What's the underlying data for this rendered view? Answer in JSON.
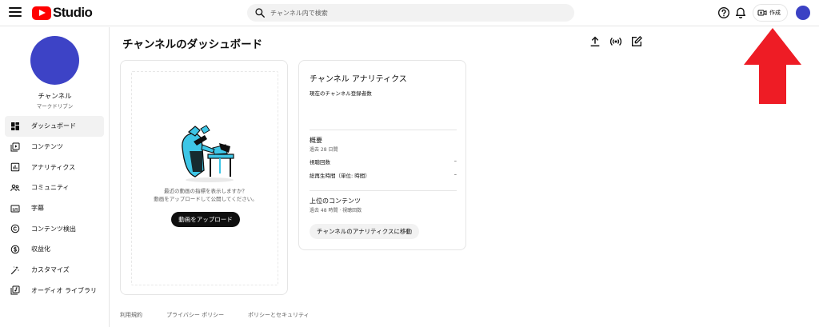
{
  "header": {
    "logo_text": "Studio",
    "search_placeholder": "チャンネル内で検索",
    "create_label": "作成"
  },
  "sidebar": {
    "channel_name": "チャンネル",
    "channel_handle": "マークドリブン",
    "items": [
      {
        "label": "ダッシュボード",
        "icon": "dashboard-icon",
        "active": true
      },
      {
        "label": "コンテンツ",
        "icon": "content-icon"
      },
      {
        "label": "アナリティクス",
        "icon": "analytics-icon"
      },
      {
        "label": "コミュニティ",
        "icon": "community-icon"
      },
      {
        "label": "字幕",
        "icon": "subtitles-icon"
      },
      {
        "label": "コンテンツ検出",
        "icon": "copyright-icon"
      },
      {
        "label": "収益化",
        "icon": "monetization-icon"
      },
      {
        "label": "カスタマイズ",
        "icon": "customize-icon"
      },
      {
        "label": "オーディオ ライブラリ",
        "icon": "audio-library-icon"
      }
    ]
  },
  "main": {
    "title": "チャンネルのダッシュボード",
    "upload_card": {
      "line1": "最近の動画の指標を表示しますか？",
      "line2": "動画をアップロードして公開してください。",
      "button": "動画をアップロード"
    },
    "analytics": {
      "title": "チャンネル アナリティクス",
      "subscribers_label": "現在のチャンネル登録者数",
      "summary_title": "概要",
      "summary_period": "過去 28 日間",
      "views_label": "視聴回数",
      "views_value": "–",
      "watch_time_label": "総再生時間（単位: 時間）",
      "watch_time_value": "–",
      "top_title": "上位のコンテンツ",
      "top_period": "過去 48 時間 · 視聴回数",
      "button": "チャンネルのアナリティクスに移動"
    }
  },
  "footer": {
    "terms": "利用規約",
    "privacy": "プライバシー ポリシー",
    "policy_safety": "ポリシーとセキュリティ"
  },
  "colors": {
    "avatar": "#3d43c6",
    "logo_red": "#ff0000",
    "annotation_arrow": "#ee1c25",
    "illustration_cyan": "#3ec6e6"
  }
}
